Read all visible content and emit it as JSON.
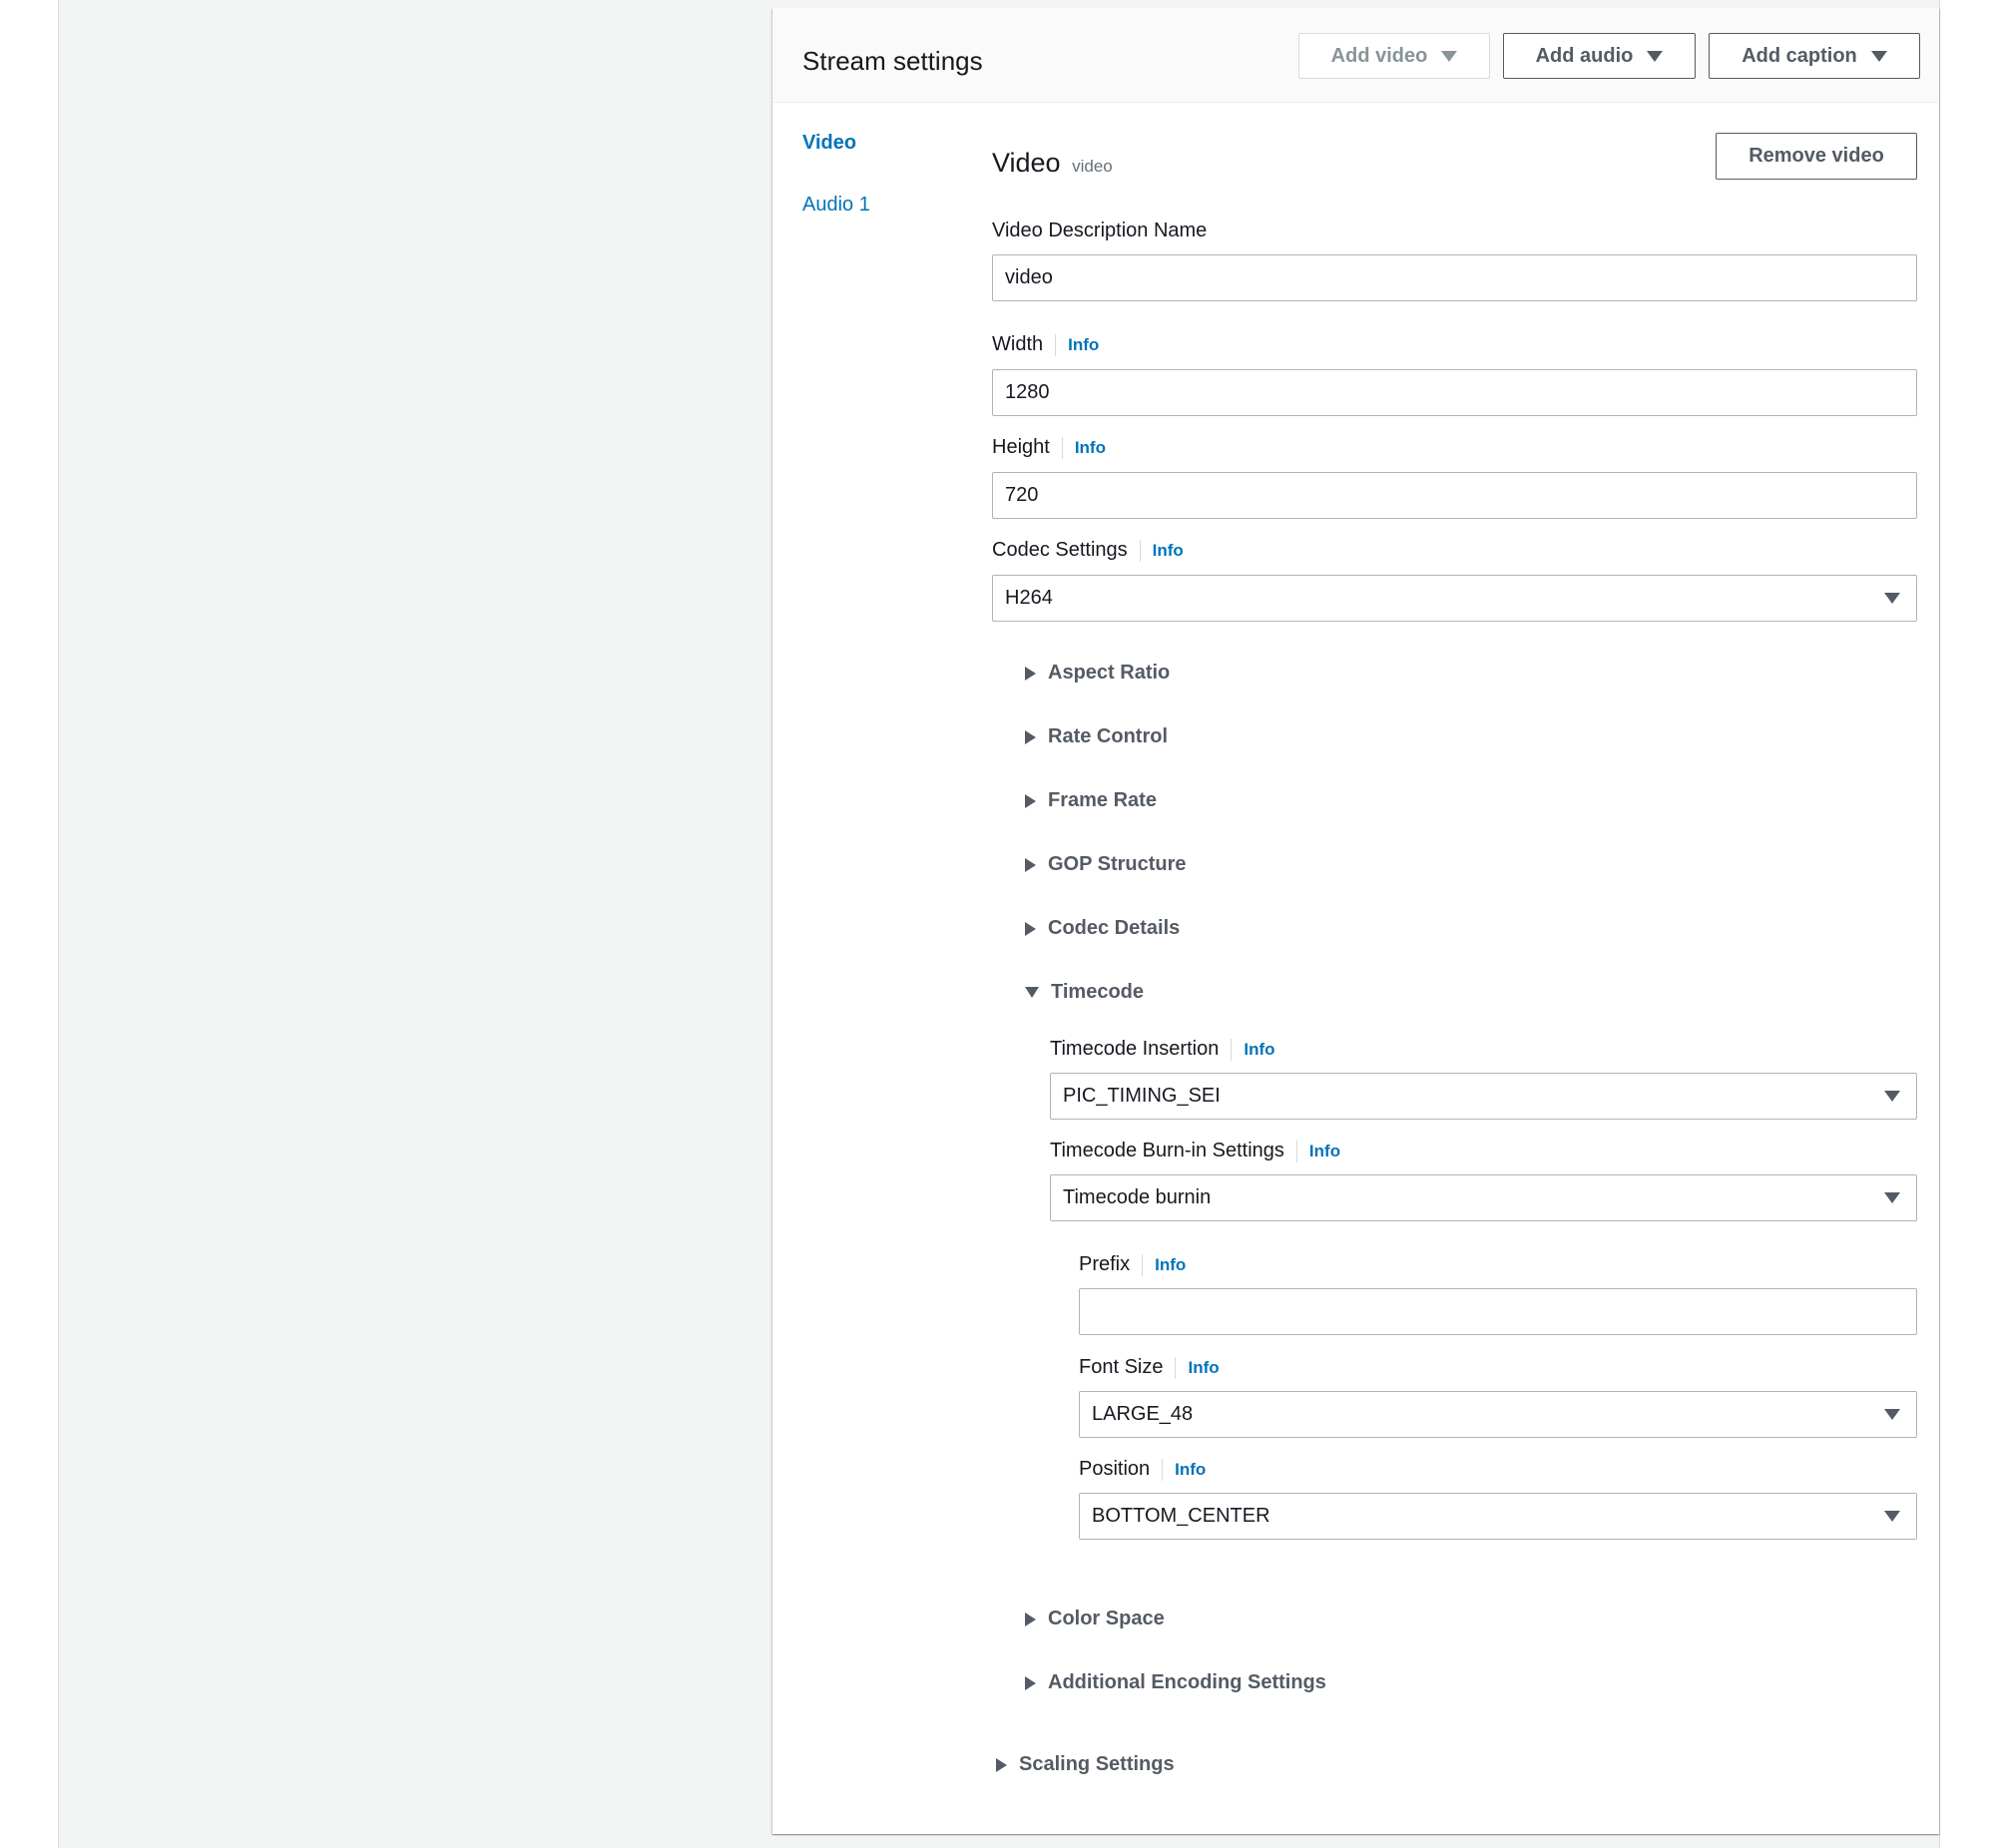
{
  "header": {
    "title": "Stream settings",
    "add_video_label": "Add video",
    "add_audio_label": "Add audio",
    "add_caption_label": "Add caption"
  },
  "nav": {
    "items": [
      {
        "label": "Video",
        "active": true
      },
      {
        "label": "Audio 1",
        "active": false
      }
    ]
  },
  "video": {
    "title": "Video",
    "subtitle": "video",
    "remove_label": "Remove video",
    "info_label": "Info",
    "description_name": {
      "label": "Video Description Name",
      "value": "video"
    },
    "width": {
      "label": "Width",
      "value": "1280"
    },
    "height": {
      "label": "Height",
      "value": "720"
    },
    "codec": {
      "label": "Codec Settings",
      "value": "H264"
    },
    "sections": {
      "aspect_ratio": "Aspect Ratio",
      "rate_control": "Rate Control",
      "frame_rate": "Frame Rate",
      "gop_structure": "GOP Structure",
      "codec_details": "Codec Details",
      "timecode": "Timecode",
      "color_space": "Color Space",
      "additional_encoding": "Additional Encoding Settings"
    },
    "timecode": {
      "insertion": {
        "label": "Timecode Insertion",
        "value": "PIC_TIMING_SEI"
      },
      "burnin": {
        "label": "Timecode Burn-in Settings",
        "value": "Timecode burnin"
      },
      "prefix": {
        "label": "Prefix",
        "value": ""
      },
      "font_size": {
        "label": "Font Size",
        "value": "LARGE_48"
      },
      "position": {
        "label": "Position",
        "value": "BOTTOM_CENTER"
      }
    },
    "scaling_settings": "Scaling Settings"
  },
  "colors": {
    "link": "#0073bb",
    "border": "#aab7b8",
    "background": "#f2f3f3"
  }
}
